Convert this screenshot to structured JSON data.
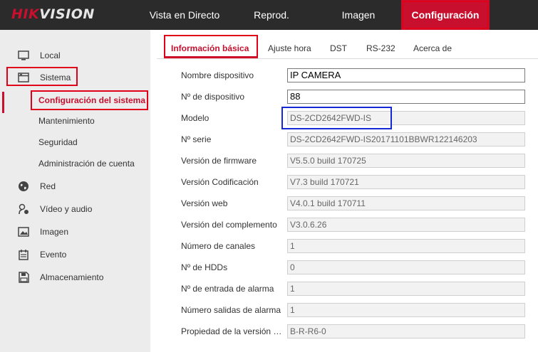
{
  "brand": {
    "part1": "HIK",
    "part2": "VISION"
  },
  "nav": [
    {
      "label": "Vista en Directo"
    },
    {
      "label": "Reprod."
    },
    {
      "label": "Imagen"
    },
    {
      "label": "Configuración",
      "active": true
    }
  ],
  "sidebar": {
    "items": [
      {
        "label": "Local",
        "icon": "monitor-icon"
      },
      {
        "label": "Sistema",
        "icon": "system-icon"
      },
      {
        "label": "Red",
        "icon": "globe-icon"
      },
      {
        "label": "Vídeo y audio",
        "icon": "video-audio-icon"
      },
      {
        "label": "Imagen",
        "icon": "image-icon"
      },
      {
        "label": "Evento",
        "icon": "event-icon"
      },
      {
        "label": "Almacenamiento",
        "icon": "storage-icon"
      }
    ],
    "subitems": [
      {
        "label": "Configuración del sistema",
        "active": true
      },
      {
        "label": "Mantenimiento"
      },
      {
        "label": "Seguridad"
      },
      {
        "label": "Administración de cuenta"
      }
    ]
  },
  "tabs": [
    {
      "label": "Información básica",
      "active": true
    },
    {
      "label": "Ajuste hora"
    },
    {
      "label": "DST"
    },
    {
      "label": "RS-232"
    },
    {
      "label": "Acerca de"
    }
  ],
  "form": [
    {
      "label": "Nombre dispositivo",
      "value": "IP CAMERA",
      "editable": true
    },
    {
      "label": "Nº de dispositivo",
      "value": "88",
      "editable": true
    },
    {
      "label": "Modelo",
      "value": "DS-2CD2642FWD-IS"
    },
    {
      "label": "Nº serie",
      "value": "DS-2CD2642FWD-IS20171101BBWR122146203"
    },
    {
      "label": "Versión de firmware",
      "value": "V5.5.0 build 170725"
    },
    {
      "label": "Versión Codificación",
      "value": "V7.3 build 170721"
    },
    {
      "label": "Versión web",
      "value": "V4.0.1 build 170711"
    },
    {
      "label": "Versión del complemento",
      "value": "V3.0.6.26"
    },
    {
      "label": "Número de canales",
      "value": "1"
    },
    {
      "label": "Nº de HDDs",
      "value": "0"
    },
    {
      "label": "Nº de entrada de alarma",
      "value": "1"
    },
    {
      "label": "Número salidas de alarma",
      "value": "1"
    },
    {
      "label": "Propiedad de la versión d...",
      "value": "B-R-R6-0"
    }
  ],
  "colors": {
    "accent": "#c8102e",
    "topbar": "#2b2b2b",
    "sidebar": "#ececec",
    "annotation_red": "#e0001a",
    "annotation_blue": "#1428d6"
  }
}
